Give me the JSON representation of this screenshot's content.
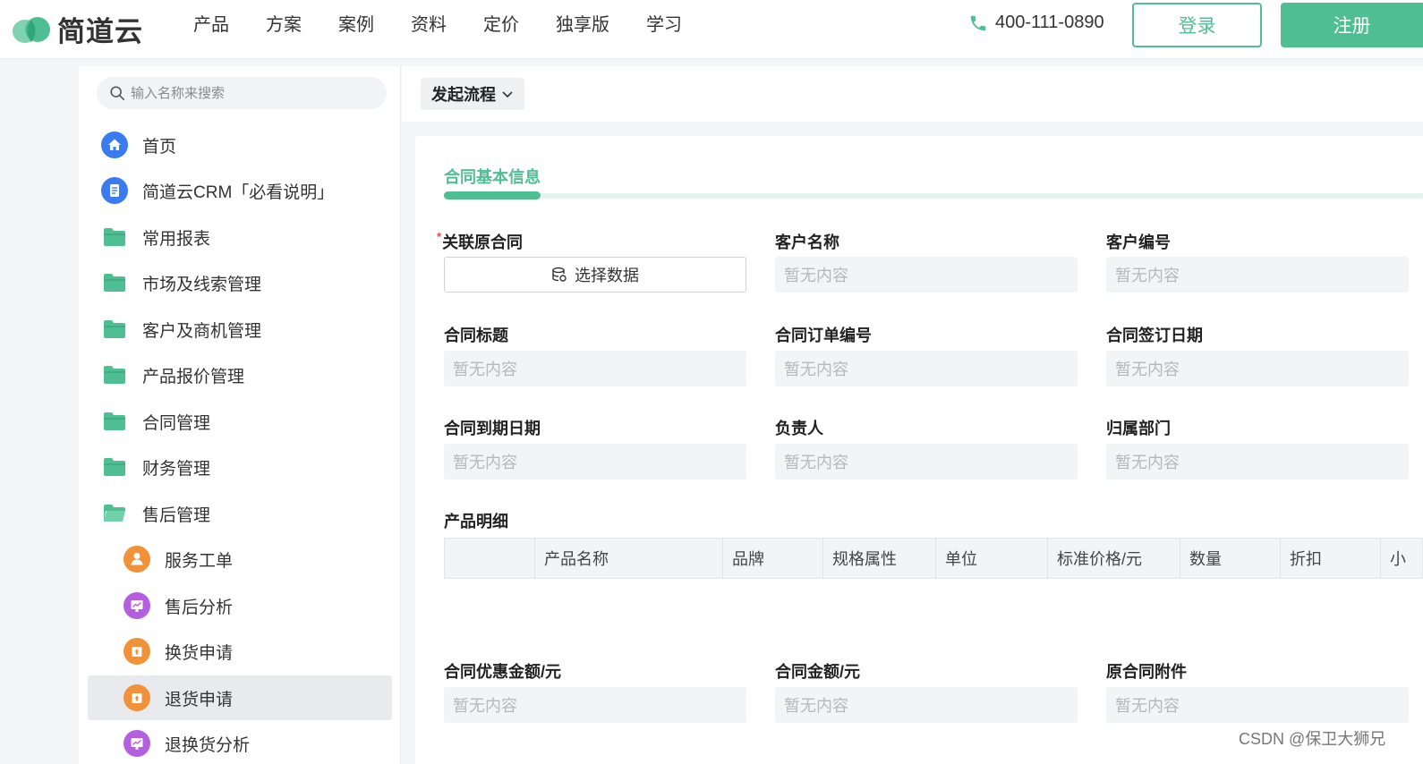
{
  "header": {
    "logo_text": "简道云",
    "nav": [
      "产品",
      "方案",
      "案例",
      "资料",
      "定价",
      "独享版",
      "学习"
    ],
    "phone": "400-111-0890",
    "login_label": "登录",
    "register_label": "注册",
    "brand_color": "#4fbf93"
  },
  "sidebar": {
    "search_placeholder": "输入名称来搜索",
    "items": [
      {
        "label": "首页",
        "icon": "home-icon"
      },
      {
        "label": "简道云CRM「必看说明」",
        "icon": "document-icon"
      },
      {
        "label": "常用报表",
        "icon": "folder-icon"
      },
      {
        "label": "市场及线索管理",
        "icon": "folder-icon"
      },
      {
        "label": "客户及商机管理",
        "icon": "folder-icon"
      },
      {
        "label": "产品报价管理",
        "icon": "folder-icon"
      },
      {
        "label": "合同管理",
        "icon": "folder-icon"
      },
      {
        "label": "财务管理",
        "icon": "folder-icon"
      },
      {
        "label": "售后管理",
        "icon": "folder-open-icon"
      },
      {
        "label": "服务工单",
        "icon": "service-icon"
      },
      {
        "label": "售后分析",
        "icon": "chart-icon"
      },
      {
        "label": "换货申请",
        "icon": "exchange-icon"
      },
      {
        "label": "退货申请",
        "icon": "return-icon",
        "active": true
      },
      {
        "label": "退换货分析",
        "icon": "chart-icon"
      }
    ]
  },
  "toolbar": {
    "flow_label": "发起流程"
  },
  "form": {
    "section_title": "合同基本信息",
    "required_mark": "*",
    "empty_text": "暂无内容",
    "select_label": "选择数据",
    "fields": {
      "related_contract": "关联原合同",
      "customer_name": "客户名称",
      "customer_no": "客户编号",
      "contract_title": "合同标题",
      "order_no": "合同订单编号",
      "sign_date": "合同签订日期",
      "expire_date": "合同到期日期",
      "owner": "负责人",
      "department": "归属部门",
      "product_detail": "产品明细",
      "discount_amount": "合同优惠金额/元",
      "contract_amount": "合同金额/元",
      "attachment": "原合同附件"
    },
    "table_columns": [
      "",
      "产品名称",
      "品牌",
      "规格属性",
      "单位",
      "标准价格/元",
      "数量",
      "折扣",
      "小"
    ]
  },
  "watermark": "CSDN @保卫大狮兄"
}
